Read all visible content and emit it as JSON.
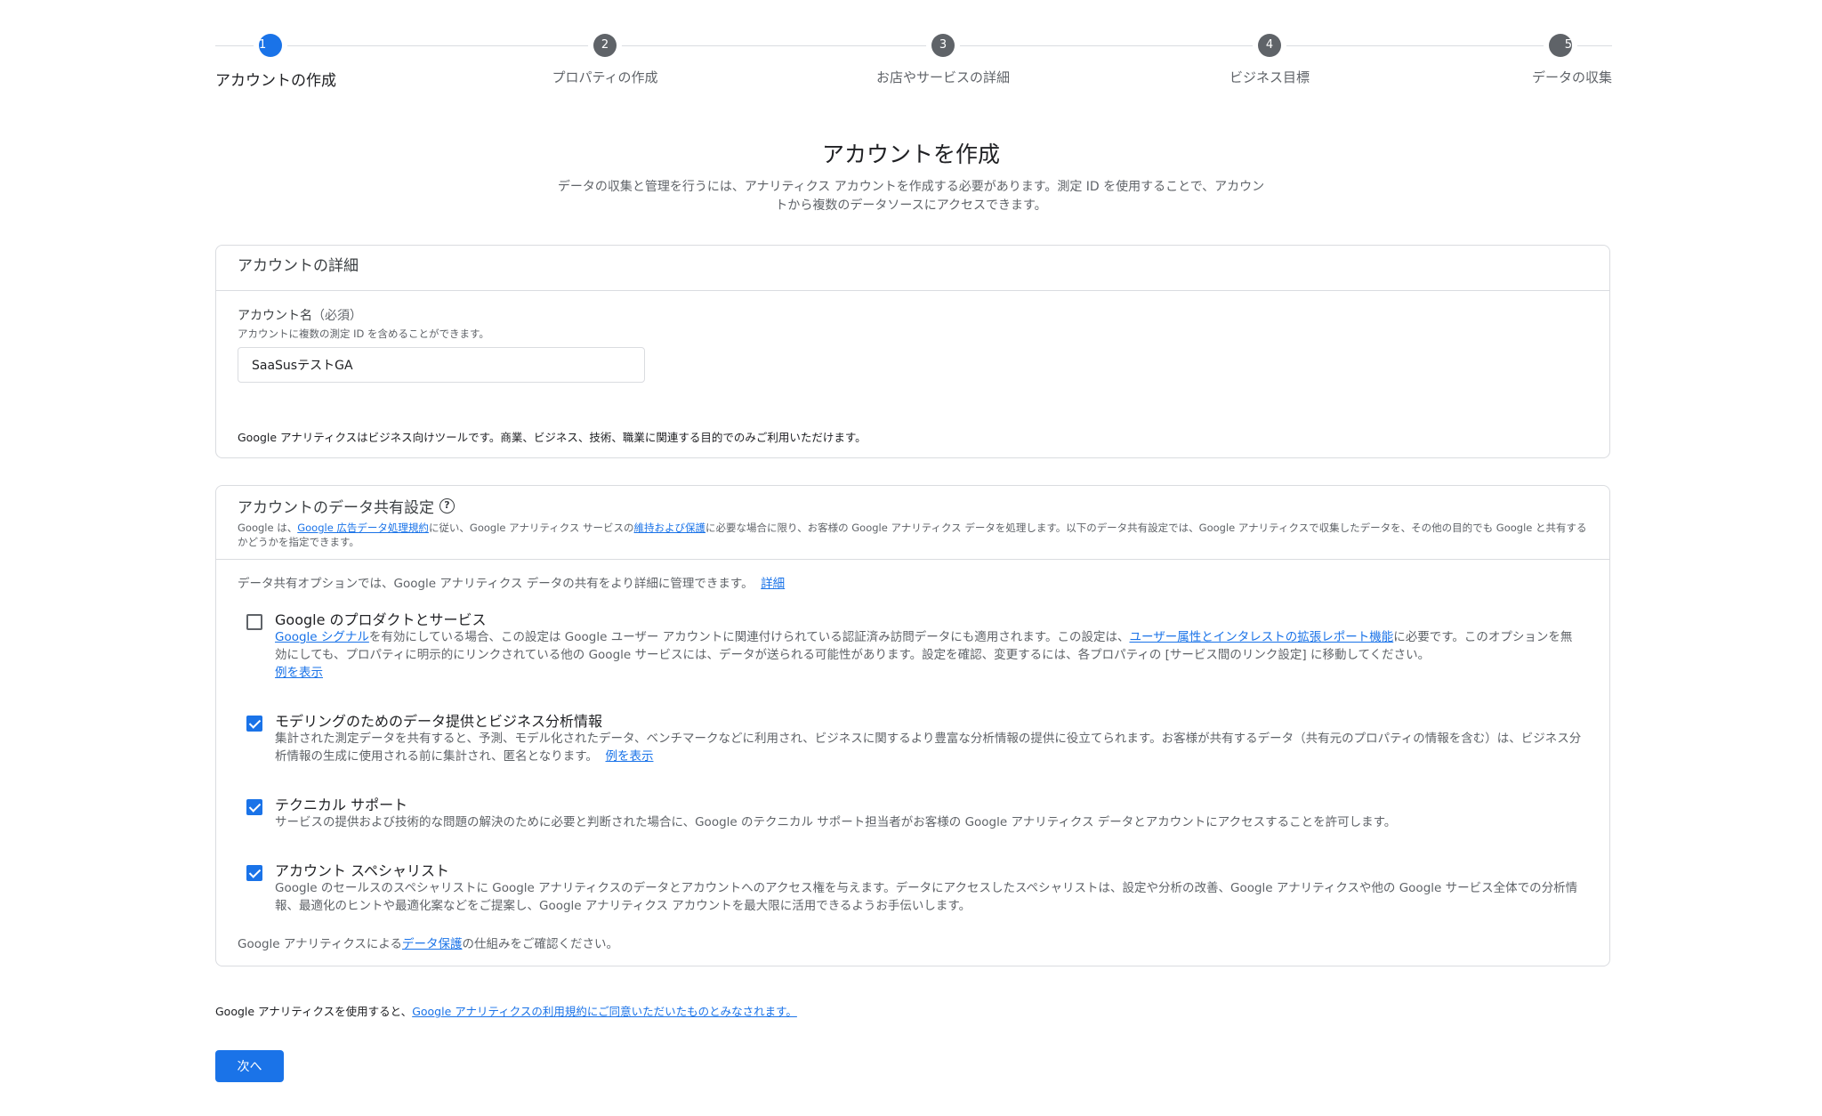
{
  "stepper": {
    "steps": [
      {
        "num": "1",
        "label": "アカウントの作成"
      },
      {
        "num": "2",
        "label": "プロパティの作成"
      },
      {
        "num": "3",
        "label": "お店やサービスの詳細"
      },
      {
        "num": "4",
        "label": "ビジネス目標"
      },
      {
        "num": "5",
        "label": "データの収集"
      }
    ]
  },
  "header": {
    "title": "アカウントを作成",
    "description": "データの収集と管理を行うには、アナリティクス アカウントを作成する必要があります。測定 ID を使用することで、アカウントから複数のデータソースにアクセスできます。"
  },
  "account_details": {
    "title": "アカウントの詳細",
    "field_label": "アカウント名",
    "field_required": "（必須）",
    "field_hint": "アカウントに複数の測定 ID を含めることができます。",
    "field_value": "SaaSusテストGA",
    "note": "Google アナリティクスはビジネス向けツールです。商業、ビジネス、技術、職業に関連する目的でのみご利用いただけます。"
  },
  "data_sharing": {
    "title": "アカウントのデータ共有設定",
    "help_icon": "?",
    "desc_1": "Google は、",
    "desc_link_1": "Google 広告データ処理規約",
    "desc_2": "に従い、Google アナリティクス サービスの",
    "desc_link_2": "維持および保護",
    "desc_3": "に必要な場合に限り、お客様の Google アナリティクス データを処理します。以下のデータ共有設定では、Google アナリティクスで収集したデータを、その他の目的でも Google と共有するかどうかを指定できます。",
    "intro": "データ共有オプションでは、Google アナリティクス データの共有をより詳細に管理できます。",
    "intro_link": "詳細",
    "options": [
      {
        "title": "Google のプロダクトとサービス",
        "checked": false,
        "link_a": "Google シグナル",
        "text_a": "を有効にしている場合、この設定は Google ユーザー アカウントに関連付けられている認証済み訪問データにも適用されます。この設定は、",
        "link_b": "ユーザー属性とインタレストの拡張レポート機能",
        "text_b": "に必要です。このオプションを無効にしても、プロパティに明示的にリンクされている他の Google サービスには、データが送られる可能性があります。設定を確認、変更するには、各プロパティの [サービス間のリンク設定] に移動してください。",
        "example_link": "例を表示"
      },
      {
        "title": "モデリングのためのデータ提供とビジネス分析情報",
        "checked": true,
        "text": "集計された測定データを共有すると、予測、モデル化されたデータ、ベンチマークなどに利用され、ビジネスに関するより豊富な分析情報の提供に役立てられます。お客様が共有するデータ（共有元のプロパティの情報を含む）は、ビジネス分析情報の生成に使用される前に集計され、匿名となります。",
        "example_link": "例を表示"
      },
      {
        "title": "テクニカル サポート",
        "checked": true,
        "text": "サービスの提供および技術的な問題の解決のために必要と判断された場合に、Google のテクニカル サポート担当者がお客様の Google アナリティクス データとアカウントにアクセスすることを許可します。"
      },
      {
        "title": "アカウント スペシャリスト",
        "checked": true,
        "text": "Google のセールスのスペシャリストに Google アナリティクスのデータとアカウントへのアクセス権を与えます。データにアクセスしたスペシャリストは、設定や分析の改善、Google アナリティクスや他の Google サービス全体での分析情報、最適化のヒントや最適化案などをご提案し、Google アナリティクス アカウントを最大限に活用できるようお手伝いします。"
      }
    ],
    "privacy_1": "Google アナリティクスによる",
    "privacy_link": "データ保護",
    "privacy_2": "の仕組みをご確認ください。"
  },
  "footer": {
    "terms_text": "Google アナリティクスを使用すると、",
    "terms_link": "Google アナリティクスの利用規約にご同意いただいたものとみなされます。",
    "next_label": "次へ"
  },
  "colors": {
    "accent": "#1a73e8",
    "step_inactive": "#5f6368",
    "border": "#dadce0"
  }
}
